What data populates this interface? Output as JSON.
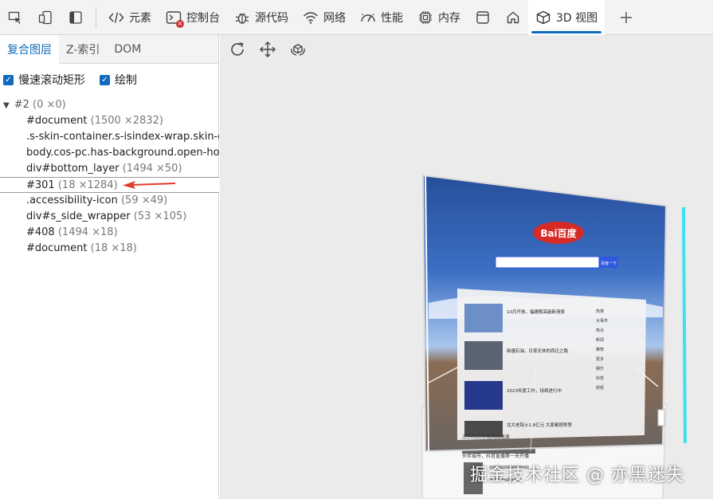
{
  "toolbar": {
    "tabs": [
      {
        "label": "元素",
        "icon": "code-icon"
      },
      {
        "label": "控制台",
        "icon": "console-icon",
        "error_count": "×"
      },
      {
        "label": "源代码",
        "icon": "bug-icon"
      },
      {
        "label": "网络",
        "icon": "wifi-icon"
      },
      {
        "label": "性能",
        "icon": "gauge-icon"
      },
      {
        "label": "内存",
        "icon": "chip-icon"
      },
      {
        "label": "3D 视图",
        "icon": "cube-icon"
      }
    ]
  },
  "left_panel": {
    "subtabs": [
      "复合图层",
      "Z-索引",
      "DOM"
    ],
    "checkboxes": [
      {
        "label": "慢速滚动矩形",
        "checked": true
      },
      {
        "label": "绘制",
        "checked": true
      }
    ],
    "tree": {
      "root": {
        "name": "#2",
        "size": "(0 ×0)"
      },
      "children": [
        {
          "name": "#document",
          "size": "(1500 ×2832)"
        },
        {
          "name": ".s-skin-container.s-isindex-wrap.skin-g",
          "size": ""
        },
        {
          "name": "body.cos-pc.has-background.open-ho",
          "size": ""
        },
        {
          "name": "div#bottom_layer",
          "size": "(1494 ×50)"
        },
        {
          "name": "#301",
          "size": "(18 ×1284)"
        },
        {
          "name": ".accessibility-icon",
          "size": "(59 ×49)"
        },
        {
          "name": "div#s_side_wrapper",
          "size": "(53 ×105)"
        },
        {
          "name": "#408",
          "size": "(1494 ×18)"
        },
        {
          "name": "#document",
          "size": "(18 ×18)"
        }
      ]
    }
  },
  "viewport": {
    "page": {
      "logo": "Bai百度",
      "search_button": "百度一下",
      "news_items": [
        "10月开放，福建舰高能新场景",
        "新疆石油，日夜无休的西迁之路",
        "2023年度工作，持续进行中",
        "北大老院士1.8亿元 大家都很称赞"
      ],
      "hot_items": [
        "热搜",
        "大事件",
        "热点",
        "新闻",
        "推荐",
        "更多",
        "娱乐",
        "科技",
        "财经"
      ]
    },
    "lower_page_items": [
      "三小时后东莞网络再发",
      "伙伴城市，抖音直播第一天开播"
    ]
  },
  "watermark": "掘金技术社区 @ 亦黑迷失",
  "colors": {
    "accent": "#0f6cbd",
    "error": "#d13438",
    "sky_top": "#2e5fb5",
    "sky_bottom": "#a9c7ec",
    "road": "#6b6460",
    "rail": "#3fe0f0",
    "search_button": "#3158e0"
  }
}
